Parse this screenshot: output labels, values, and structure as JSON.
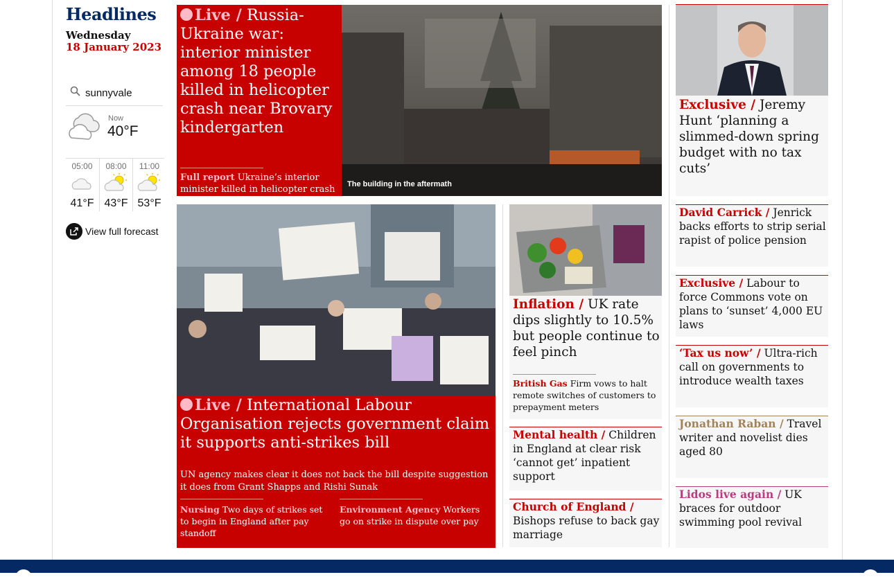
{
  "sidebar": {
    "title": "Headlines",
    "date_day": "Wednesday",
    "date_full": "18 January 2023",
    "search_icon": "search-icon",
    "location": "sunnyvale",
    "now_label": "Now",
    "now_temp": "40°F",
    "now_icon": "cloudy-icon",
    "hourly": [
      {
        "time": "05:00",
        "temp": "41°F",
        "icon": "cloud-icon"
      },
      {
        "time": "08:00",
        "temp": "43°F",
        "icon": "sun-behind-cloud-icon"
      },
      {
        "time": "11:00",
        "temp": "53°F",
        "icon": "sun-behind-cloud-icon"
      }
    ],
    "forecast_label": "View full forecast"
  },
  "lead": {
    "kicker": "Live /",
    "headline": "Russia-Ukraine war: interior minister among 18 people killed in helicopter crash near Brovary kindergarten",
    "sub_kicker": "Full report",
    "sub_text": "Ukraine’s interior minister killed in helicopter crash",
    "caption": "The building in the aftermath"
  },
  "second": {
    "kicker": "Live /",
    "headline": "International Labour Organisation rejects government claim it supports anti-strikes bill",
    "standfirst": "UN agency makes clear it does not back the bill despite suggestion it does from Grant Shapps and Rishi Sunak",
    "sublinks": [
      {
        "kicker": "Nursing",
        "text": "Two days of strikes set to begin in England after pay standoff"
      },
      {
        "kicker": "Environment Agency",
        "text": "Workers go on strike in dispute over pay"
      }
    ]
  },
  "inflation": {
    "kicker": "Inflation /",
    "headline": "UK rate dips slightly to 10.5% but people continue to feel pinch",
    "sub_kicker": "British Gas",
    "sub_text": "Firm vows to halt remote switches of customers to prepayment meters"
  },
  "middle_small": [
    {
      "kicker": "Mental health /",
      "headline": "Children in England at clear risk ‘cannot get’ inpatient support"
    },
    {
      "kicker": "Church of England /",
      "headline": "Bishops refuse to back gay marriage"
    }
  ],
  "right_top": {
    "kicker": "Exclusive /",
    "headline": "Jeremy Hunt ‘planning a slimmed-down spring budget with no tax cuts’"
  },
  "right_small": [
    {
      "kicker": "David Carrick /",
      "headline": "Jenrick backs efforts to strip serial rapist of police pension",
      "color": "#c70000"
    },
    {
      "kicker": "Exclusive /",
      "headline": "Labour to force Commons vote on plans to ‘sunset’ 4,000 EU laws",
      "color": "#c70000"
    },
    {
      "kicker": "‘Tax us now’  /",
      "headline": "Ultra-rich call on governments to introduce wealth taxes",
      "color": "#c70000"
    },
    {
      "kicker": "Jonathan Raban /",
      "headline": "Travel writer and novelist dies aged 80",
      "color": "#a1845c"
    },
    {
      "kicker": "Lidos live again /",
      "headline": "UK braces for outdoor swimming pool revival",
      "color": "#bb3b80"
    }
  ],
  "colors": {
    "news_red": "#c70000",
    "live_pink": "#ffbac8",
    "brand_blue": "#052962",
    "culture_gold": "#a1845c",
    "lifestyle_pink": "#bb3b80"
  }
}
